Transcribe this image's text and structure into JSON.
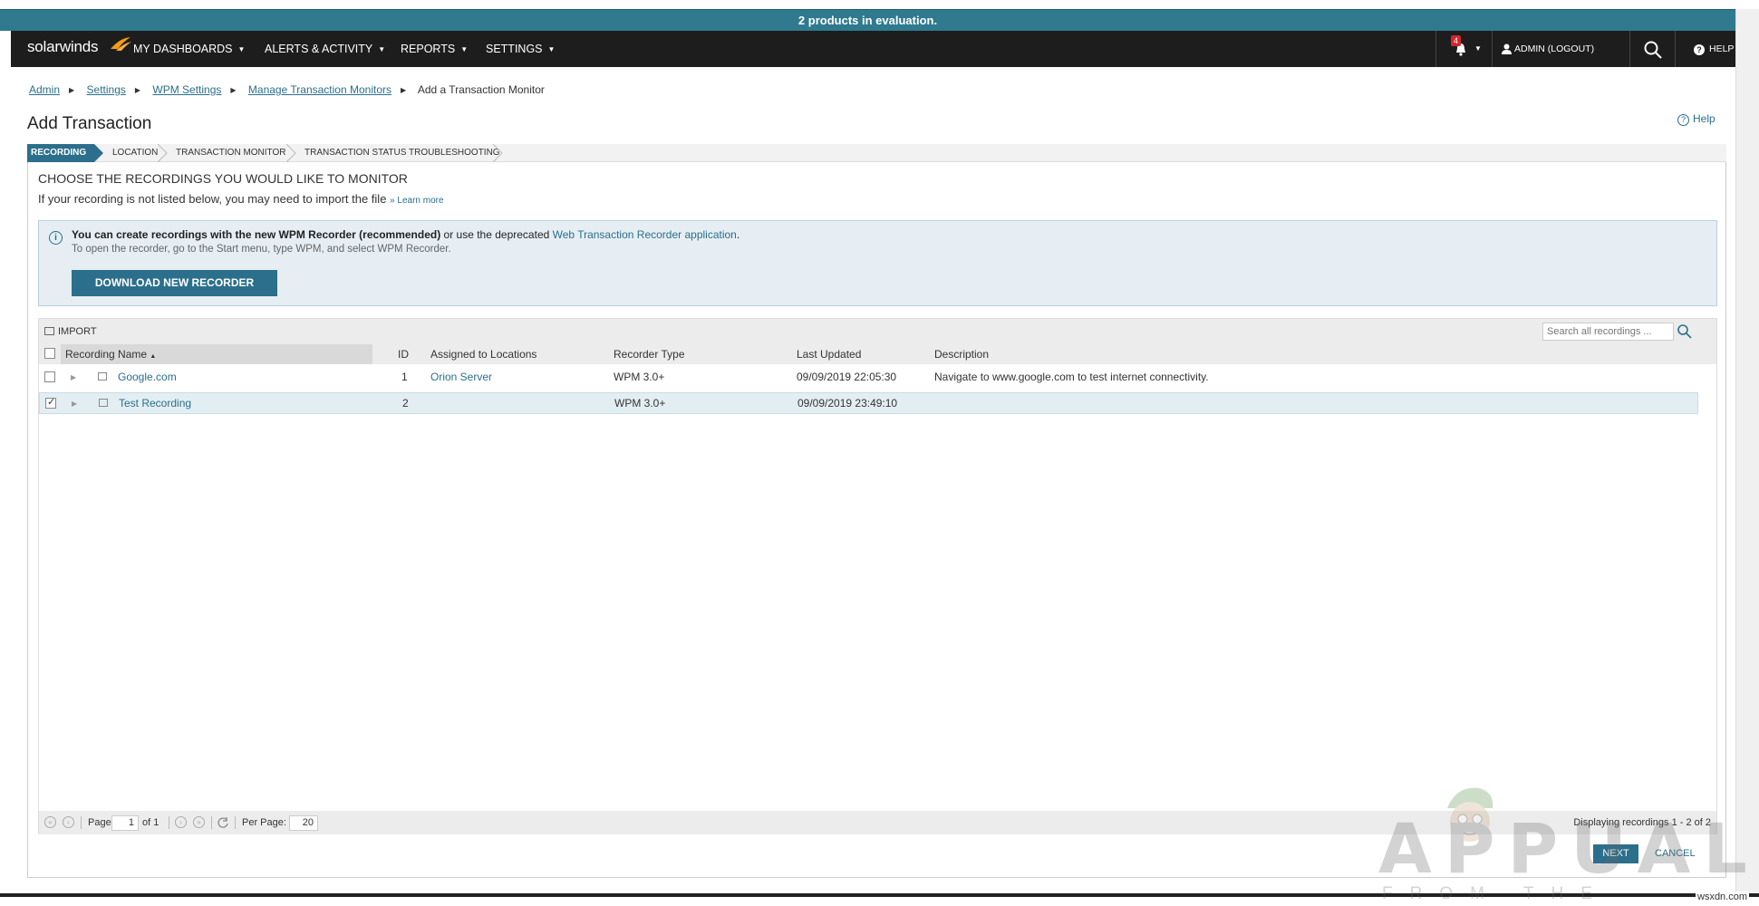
{
  "banner": "2 products in evaluation.",
  "nav": {
    "logo": "solarwinds",
    "items": [
      "MY DASHBOARDS",
      "ALERTS & ACTIVITY",
      "REPORTS",
      "SETTINGS"
    ],
    "alert_count": "4",
    "admin": "ADMIN (LOGOUT)",
    "help": "HELP"
  },
  "breadcrumb": {
    "items": [
      "Admin",
      "Settings",
      "WPM Settings",
      "Manage Transaction Monitors"
    ],
    "current": "Add a Transaction Monitor"
  },
  "page": {
    "title": "Add Transaction",
    "help": "Help"
  },
  "wizard": [
    "RECORDING",
    "LOCATION",
    "TRANSACTION MONITOR",
    "TRANSACTION STATUS TROUBLESHOOTING"
  ],
  "section": {
    "title": "CHOOSE THE RECORDINGS YOU WOULD LIKE TO MONITOR",
    "subtext": "If your recording is not listed below, you may need to import the file",
    "learn_more": "» Learn more"
  },
  "info": {
    "bold": "You can create recordings with the new WPM Recorder (recommended)",
    "middle": " or use the deprecated ",
    "link": "Web Transaction Recorder application",
    "end": ".",
    "line2": "To open the recorder, go to the Start menu, type WPM, and select WPM Recorder.",
    "button": "DOWNLOAD NEW RECORDER"
  },
  "grid": {
    "import": "IMPORT",
    "search_placeholder": "Search all recordings ...",
    "columns": {
      "name": "Recording Name",
      "id": "ID",
      "locations": "Assigned to Locations",
      "type": "Recorder Type",
      "updated": "Last Updated",
      "description": "Description"
    },
    "rows": [
      {
        "name": "Google.com",
        "id": "1",
        "locations": "Orion Server",
        "type": "WPM 3.0+",
        "updated": "09/09/2019 22:05:30",
        "description": "Navigate to www.google.com to test internet connectivity.",
        "checked": false
      },
      {
        "name": "Test Recording",
        "id": "2",
        "locations": "",
        "type": "WPM 3.0+",
        "updated": "09/09/2019 23:49:10",
        "description": "",
        "checked": true
      }
    ]
  },
  "pager": {
    "page_label": "Page",
    "page_value": "1",
    "of": "of 1",
    "per_page_label": "Per Page:",
    "per_page_value": "20",
    "display": "Displaying recordings 1 - 2 of 2"
  },
  "actions": {
    "next": "NEXT",
    "cancel": "CANCEL"
  },
  "watermark": {
    "text": "APPUALS",
    "sub": "FROM THE EXPERTS",
    "site": "wsxdn.com"
  },
  "colors": {
    "accent": "#2b6f8c",
    "banner": "#2f7a8f",
    "navbar": "#1d1d1d",
    "alert": "#d4252c",
    "info_bg": "#e6eef4"
  }
}
